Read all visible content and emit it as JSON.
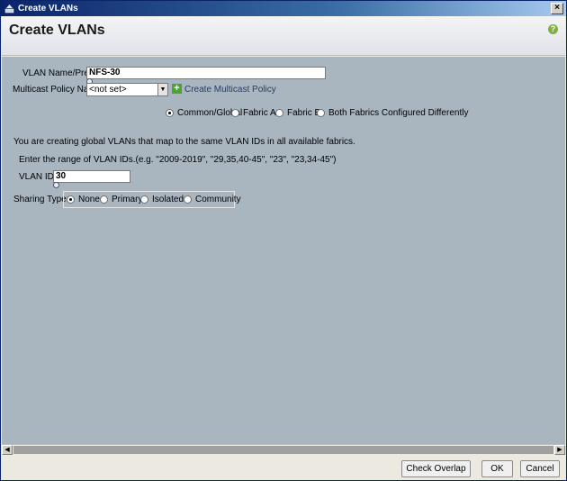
{
  "window": {
    "title": "Create VLANs",
    "close_glyph": "×",
    "help_glyph": "?"
  },
  "header": {
    "title": "Create VLANs"
  },
  "form": {
    "vlan_name_label": "VLAN Name/Prefix:",
    "vlan_name_value": "NFS-30",
    "multicast_label": "Multicast Policy Name:",
    "multicast_value": "<not set>",
    "create_multicast_link": "Create Multicast Policy",
    "fabric_options": [
      {
        "label": "Common/Global",
        "selected": true
      },
      {
        "label": "Fabric A",
        "selected": false
      },
      {
        "label": "Fabric B",
        "selected": false
      },
      {
        "label": "Both Fabrics Configured Differently",
        "selected": false
      }
    ],
    "info_text": "You are creating global VLANs that map to the same VLAN IDs in all available fabrics.",
    "range_hint": "Enter the range of VLAN IDs.(e.g. \"2009-2019\", \"29,35,40-45\", \"23\", \"23,34-45\")",
    "vlan_ids_label": "VLAN IDs:",
    "vlan_ids_value": "30",
    "sharing_label": "Sharing Type:",
    "sharing_options": [
      {
        "label": "None",
        "selected": true
      },
      {
        "label": "Primary",
        "selected": false
      },
      {
        "label": "Isolated",
        "selected": false
      },
      {
        "label": "Community",
        "selected": false
      }
    ]
  },
  "buttons": {
    "check_overlap": "Check Overlap",
    "ok": "OK",
    "cancel": "Cancel"
  },
  "icons": {
    "app": "vlan-app-icon",
    "help": "help-icon",
    "plus": "plus-icon",
    "info": "info-icon"
  },
  "colors": {
    "content_bg": "#a9b6c0",
    "titlebar": "#0a246a",
    "plus_icon": "#4aa432"
  }
}
